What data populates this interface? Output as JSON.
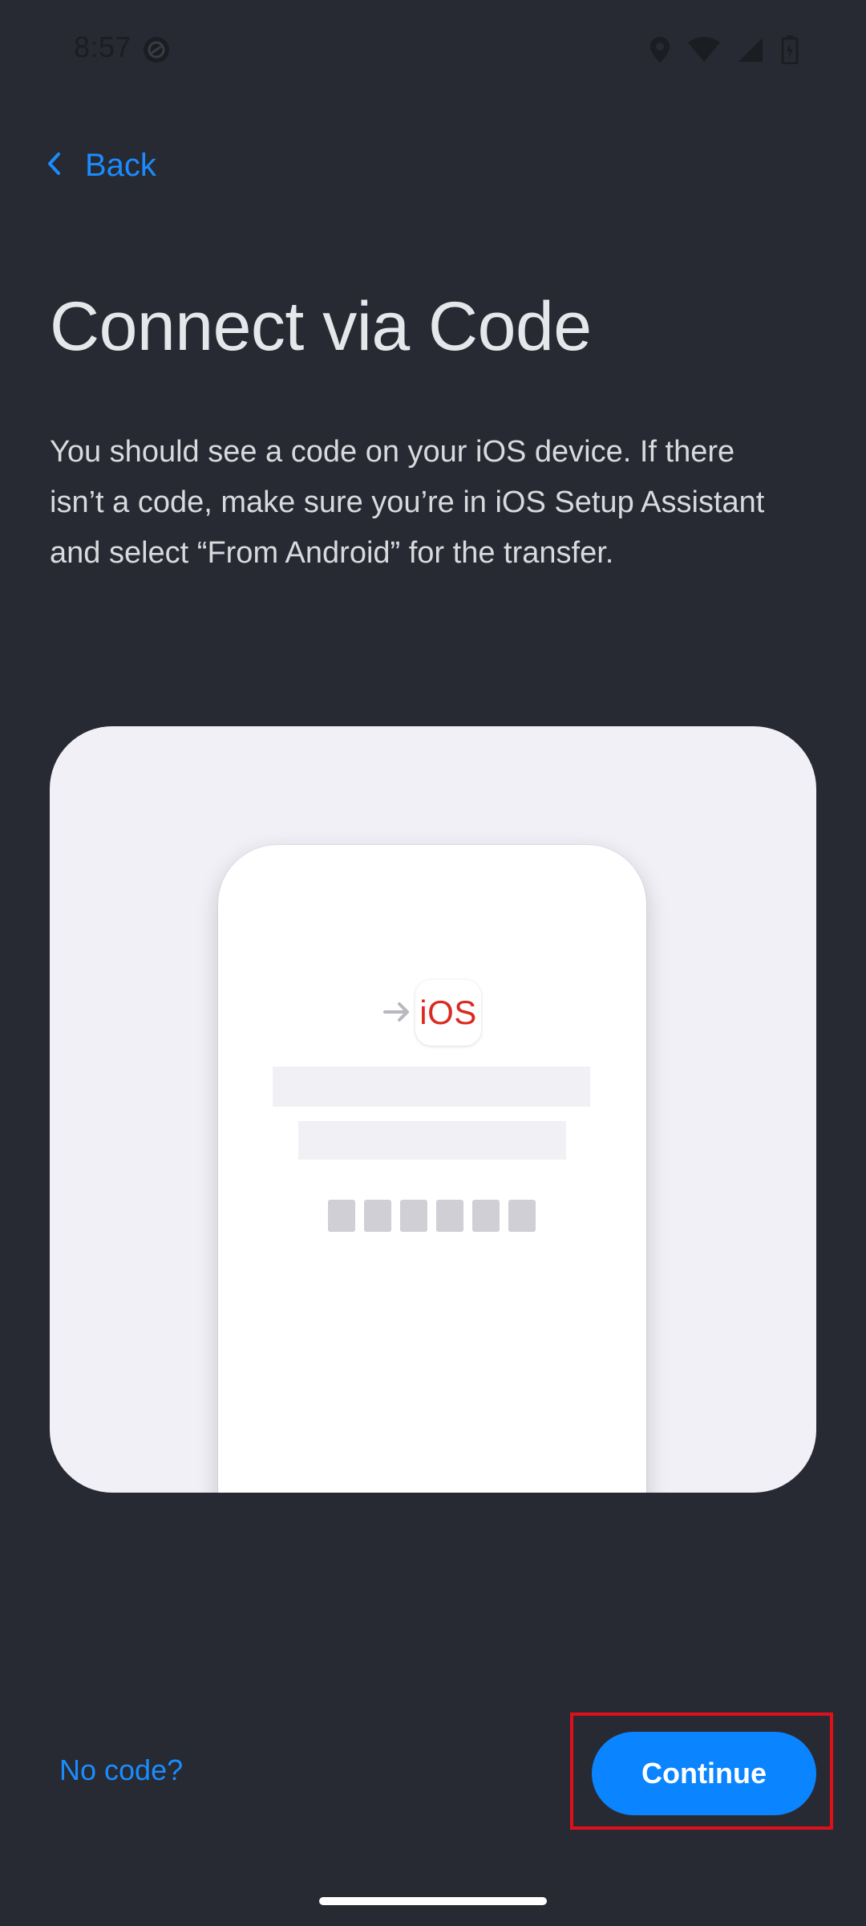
{
  "status_bar": {
    "time": "8:57",
    "icons": [
      "app-notification-icon",
      "location-icon",
      "wifi-icon",
      "cellular-signal-icon",
      "battery-charging-icon"
    ]
  },
  "navigation": {
    "back_label": "Back"
  },
  "title": "Connect via Code",
  "description": "You should see a code on your iOS device. If there isn’t a code, make sure you’re in iOS Setup Assistant and select “From Android” for the transfer.",
  "illustration": {
    "logo_text": "iOS",
    "code_box_count": 6
  },
  "actions": {
    "no_code_label": "No code?",
    "continue_label": "Continue"
  },
  "colors": {
    "background": "#272a32",
    "accent": "#0a84ff",
    "link": "#1a8cff",
    "highlight": "#e0101a",
    "ios_red": "#d92a1f"
  }
}
